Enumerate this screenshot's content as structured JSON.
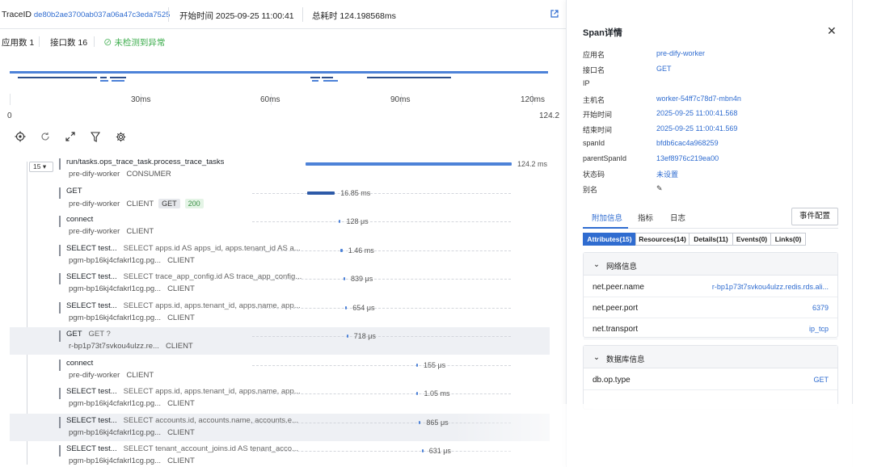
{
  "header": {
    "trace_label": "TraceID",
    "trace_id": "de80b2ae3700ab037a06a47c3eda7525",
    "start_label": "开始时间",
    "start_time": "2025-09-25 11:00:41",
    "total_label": "总耗时",
    "total_time": "124.198568ms",
    "app_count": "应用数 1",
    "iface_count": "接口数 16",
    "anomaly_status": "未检测到异常"
  },
  "axis": {
    "ticks": [
      "0",
      "30ms",
      "60ms",
      "90ms",
      "120ms"
    ],
    "end_value": "124.2"
  },
  "rows": [
    {
      "name": "run/tasks.ops_trace_task.process_trace_tasks",
      "sub": "",
      "service": "pre-dify-worker",
      "kind": "CONSUMER",
      "duration": "124.2 ms",
      "start_ms": 0,
      "dur_ms": 124.2,
      "depth": 0,
      "collapse_count": "15"
    },
    {
      "name": "GET",
      "sub": "",
      "service": "pre-dify-worker",
      "kind": "CLIENT",
      "tags": [
        "GET",
        "200"
      ],
      "duration": "16.85 ms",
      "start_ms": 0.8,
      "dur_ms": 16.85,
      "depth": 1
    },
    {
      "name": "connect",
      "sub": "",
      "service": "pre-dify-worker",
      "kind": "CLIENT",
      "duration": "128 μs",
      "start_ms": 20.2,
      "dur_ms": 0.128,
      "depth": 1
    },
    {
      "name": "SELECT test...",
      "sub": "SELECT apps.id AS apps_id, apps.tenant_id AS a...",
      "service": "pgm-bp16kj4cfakrl1cg.pg...",
      "kind": "CLIENT",
      "duration": "1.46 ms",
      "start_ms": 20.8,
      "dur_ms": 1.46,
      "depth": 1
    },
    {
      "name": "SELECT test...",
      "sub": "SELECT trace_app_config.id AS trace_app_config...",
      "service": "pgm-bp16kj4cfakrl1cg.pg...",
      "kind": "CLIENT",
      "duration": "839 μs",
      "start_ms": 22.9,
      "dur_ms": 0.839,
      "depth": 1
    },
    {
      "name": "SELECT test...",
      "sub": "SELECT apps.id, apps.tenant_id, apps.name, app...",
      "service": "pgm-bp16kj4cfakrl1cg.pg...",
      "kind": "CLIENT",
      "duration": "654 μs",
      "start_ms": 24.0,
      "dur_ms": 0.654,
      "depth": 1
    },
    {
      "name": "GET",
      "sub": "GET ?",
      "service": "r-bp1p73t7svkou4ulzz.re...",
      "kind": "CLIENT",
      "duration": "718 μs",
      "start_ms": 24.7,
      "dur_ms": 0.718,
      "depth": 1,
      "highlight": true
    },
    {
      "name": "connect",
      "sub": "",
      "service": "pre-dify-worker",
      "kind": "CLIENT",
      "duration": "155 μs",
      "start_ms": 66.7,
      "dur_ms": 0.155,
      "depth": 1
    },
    {
      "name": "SELECT test...",
      "sub": "SELECT apps.id, apps.tenant_id, apps.name, app...",
      "service": "pgm-bp16kj4cfakrl1cg.pg...",
      "kind": "CLIENT",
      "duration": "1.05 ms",
      "start_ms": 66.9,
      "dur_ms": 1.05,
      "depth": 1
    },
    {
      "name": "SELECT test...",
      "sub": "SELECT accounts.id, accounts.name, accounts.e...",
      "service": "pgm-bp16kj4cfakrl1cg.pg...",
      "kind": "CLIENT",
      "duration": "865 μs",
      "start_ms": 68.4,
      "dur_ms": 0.865,
      "depth": 1,
      "highlight": true
    },
    {
      "name": "SELECT test...",
      "sub": "SELECT tenant_account_joins.id AS tenant_acco...",
      "service": "pgm-bp16kj4cfakrl1cg.pg...",
      "kind": "CLIENT",
      "duration": "631 μs",
      "start_ms": 70.0,
      "dur_ms": 0.631,
      "depth": 1
    }
  ],
  "panel": {
    "title": "Span详情",
    "fields": [
      {
        "k": "应用名",
        "v": "pre-dify-worker"
      },
      {
        "k": "接口名",
        "v": "GET"
      },
      {
        "k": "IP",
        "v": ""
      },
      {
        "k": "主机名",
        "v": "worker-54ff7c78d7-mbn4n"
      },
      {
        "k": "开始时间",
        "v": "2025-09-25 11:00:41.568"
      },
      {
        "k": "结束时间",
        "v": "2025-09-25 11:00:41.569"
      },
      {
        "k": "spanId",
        "v": "bfdb6cac4a968259"
      },
      {
        "k": "parentSpanId",
        "v": "13ef8976c219ea00"
      },
      {
        "k": "状态码",
        "v": "未设置"
      },
      {
        "k": "别名",
        "v": ""
      }
    ],
    "tabs": [
      "附加信息",
      "指标",
      "日志"
    ],
    "event_button": "事件配置",
    "subtabs": [
      "Attributes(15)",
      "Resources(14)",
      "Details(11)",
      "Events(0)",
      "Links(0)"
    ],
    "network_group": "网络信息",
    "network_items": [
      {
        "k": "net.peer.name",
        "v": "r-bp1p73t7svkou4ulzz.redis.rds.ali..."
      },
      {
        "k": "net.peer.port",
        "v": "6379"
      },
      {
        "k": "net.transport",
        "v": "ip_tcp"
      }
    ],
    "db_group": "数据库信息",
    "db_items": [
      {
        "k": "db.op.type",
        "v": "GET"
      }
    ]
  },
  "colors": {
    "accent": "#2f6cd0",
    "bar": "#4d82d8",
    "ok": "#3fae4f"
  }
}
